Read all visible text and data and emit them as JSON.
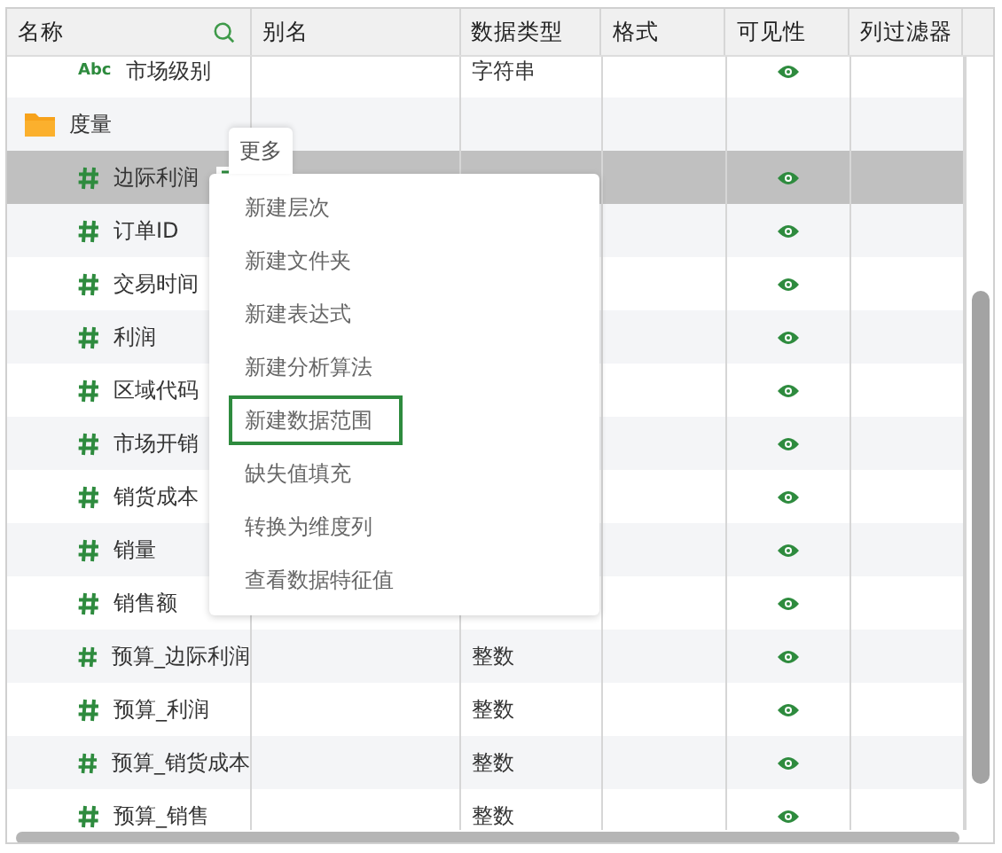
{
  "columns": [
    "名称",
    "别名",
    "数据类型",
    "格式",
    "可见性",
    "列过滤器"
  ],
  "tree": [
    {
      "children": [
        {
          "kind": "text",
          "icon_text": "Abc",
          "name": "市场级别",
          "data_type": "字符串",
          "visible": true,
          "selected": false
        }
      ]
    },
    {
      "kind": "folder",
      "name": "度量",
      "selected": false,
      "children": [
        {
          "kind": "number",
          "name": "边际利润",
          "visible": true,
          "selected": true
        },
        {
          "kind": "number",
          "name": "订单ID",
          "visible": true,
          "selected": false
        },
        {
          "kind": "number",
          "name": "交易时间",
          "visible": true,
          "selected": false
        },
        {
          "kind": "number",
          "name": "利润",
          "visible": true,
          "selected": false
        },
        {
          "kind": "number",
          "name": "区域代码",
          "visible": true,
          "selected": false
        },
        {
          "kind": "number",
          "name": "市场开销",
          "visible": true,
          "selected": false
        },
        {
          "kind": "number",
          "name": "销货成本",
          "visible": true,
          "selected": false
        },
        {
          "kind": "number",
          "name": "销量",
          "visible": true,
          "selected": false
        },
        {
          "kind": "number",
          "name": "销售额",
          "visible": true,
          "selected": false
        },
        {
          "kind": "number",
          "name": "预算_边际利润",
          "data_type": "整数",
          "visible": true,
          "selected": false
        },
        {
          "kind": "number",
          "name": "预算_利润",
          "data_type": "整数",
          "visible": true,
          "selected": false
        },
        {
          "kind": "number",
          "name": "预算_销货成本",
          "data_type": "整数",
          "visible": true,
          "selected": false
        },
        {
          "kind": "number",
          "name": "预算_销售",
          "data_type": "整数",
          "visible": true,
          "selected": false
        }
      ]
    }
  ],
  "menu": {
    "title": "更多",
    "items": [
      {
        "label": "新建层次",
        "selected": false
      },
      {
        "label": "新建文件夹",
        "selected": false
      },
      {
        "label": "新建表达式",
        "selected": false
      },
      {
        "label": "新建分析算法",
        "selected": false
      },
      {
        "label": "新建数据范围",
        "selected": true
      },
      {
        "label": "缺失值填充",
        "selected": false
      },
      {
        "label": "转换为维度列",
        "selected": false
      },
      {
        "label": "查看数据特征值",
        "selected": false
      }
    ]
  }
}
